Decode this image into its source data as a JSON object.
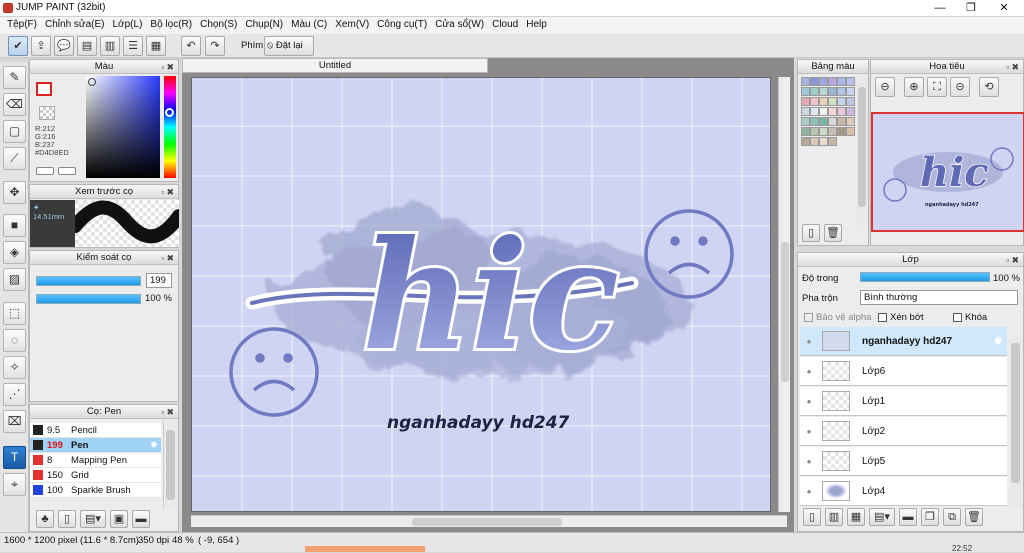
{
  "window": {
    "title": "JUMP PAINT (32bit)",
    "minimize": "—",
    "maximize": "❐",
    "close": "✕"
  },
  "menu": [
    "Tệp(F)",
    "Chỉnh sửa(E)",
    "Lớp(L)",
    "Bộ lọc(R)",
    "Chọn(S)",
    "Chụp(N)",
    "Màu (C)",
    "Xem(V)",
    "Công cụ(T)",
    "Cửa sổ(W)",
    "Cloud",
    "Help"
  ],
  "toolbar": {
    "shortcut_label": "Phím",
    "reset_label": "Đặt lại"
  },
  "color_panel": {
    "title": "Màu",
    "r": "R:212",
    "g": "G:216",
    "b": "B:237",
    "hex": "#D4D8ED",
    "fg_color": "#ffffff",
    "bg_color": "#ffffff"
  },
  "brush_preview": {
    "title": "Xem trước cọ",
    "size": "14.51mm"
  },
  "brush_control": {
    "title": "Kiểm soát cọ",
    "size_value": "199",
    "opacity_value": "100 %"
  },
  "brush_list": {
    "title": "Cọ: Pen",
    "items": [
      {
        "size": "9.5",
        "name": "Pencil",
        "color": "#222222"
      },
      {
        "size": "199",
        "name": "Pen",
        "color": "#222222"
      },
      {
        "size": "8",
        "name": "Mapping Pen",
        "color": "#e03030"
      },
      {
        "size": "150",
        "name": "Grid",
        "color": "#e03030"
      },
      {
        "size": "100",
        "name": "Sparkle Brush",
        "color": "#2244dd"
      }
    ]
  },
  "document": {
    "tab_title": "Untitled"
  },
  "artwork": {
    "main_text": "hic",
    "caption": "nganhadayy hd247"
  },
  "palette_panel": {
    "title": "Bảng màu"
  },
  "navigator": {
    "title": "Hoa tiêu"
  },
  "layers_panel": {
    "title": "Lớp",
    "opacity_label": "Độ trong",
    "opacity_value": "100 %",
    "blend_label": "Pha trộn",
    "blend_value": "Bình thường",
    "protect_alpha": "Bảo vệ alpha",
    "clipping": "Xén bớt",
    "lock": "Khóa",
    "layers": [
      {
        "name": "nganhadayy hd247"
      },
      {
        "name": "Lớp6"
      },
      {
        "name": "Lớp1"
      },
      {
        "name": "Lớp2"
      },
      {
        "name": "Lớp5"
      },
      {
        "name": "Lớp4"
      }
    ]
  },
  "status": {
    "size": "1600 * 1200 pixel",
    "physical": "(11.6 * 8.7cm)",
    "dpi": "350 dpi",
    "zoom": "48 %",
    "coords": "( -9, 654 )",
    "clock": "22:52"
  }
}
